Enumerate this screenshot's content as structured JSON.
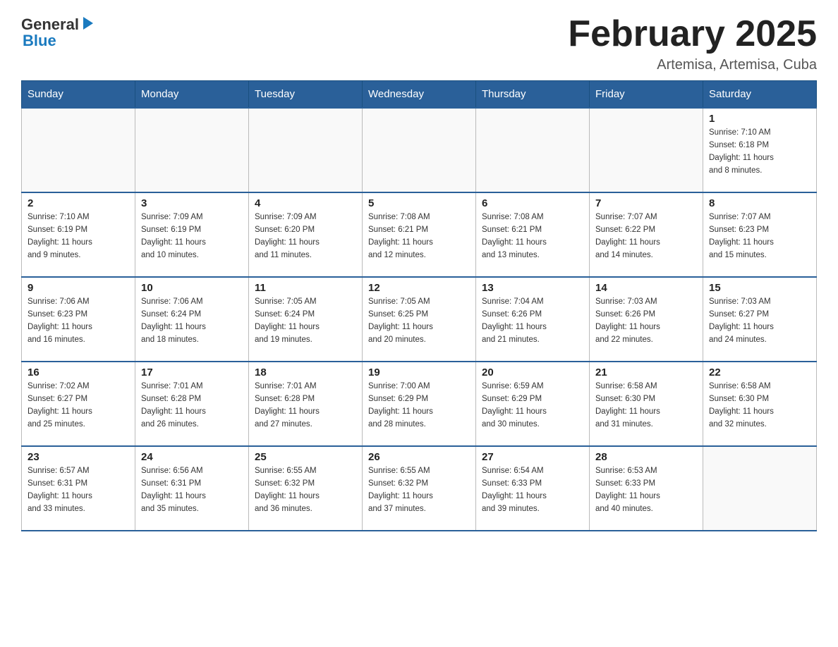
{
  "logo": {
    "general": "General",
    "blue": "Blue"
  },
  "header": {
    "month_title": "February 2025",
    "location": "Artemisa, Artemisa, Cuba"
  },
  "weekdays": [
    "Sunday",
    "Monday",
    "Tuesday",
    "Wednesday",
    "Thursday",
    "Friday",
    "Saturday"
  ],
  "weeks": [
    [
      {
        "day": "",
        "info": ""
      },
      {
        "day": "",
        "info": ""
      },
      {
        "day": "",
        "info": ""
      },
      {
        "day": "",
        "info": ""
      },
      {
        "day": "",
        "info": ""
      },
      {
        "day": "",
        "info": ""
      },
      {
        "day": "1",
        "info": "Sunrise: 7:10 AM\nSunset: 6:18 PM\nDaylight: 11 hours\nand 8 minutes."
      }
    ],
    [
      {
        "day": "2",
        "info": "Sunrise: 7:10 AM\nSunset: 6:19 PM\nDaylight: 11 hours\nand 9 minutes."
      },
      {
        "day": "3",
        "info": "Sunrise: 7:09 AM\nSunset: 6:19 PM\nDaylight: 11 hours\nand 10 minutes."
      },
      {
        "day": "4",
        "info": "Sunrise: 7:09 AM\nSunset: 6:20 PM\nDaylight: 11 hours\nand 11 minutes."
      },
      {
        "day": "5",
        "info": "Sunrise: 7:08 AM\nSunset: 6:21 PM\nDaylight: 11 hours\nand 12 minutes."
      },
      {
        "day": "6",
        "info": "Sunrise: 7:08 AM\nSunset: 6:21 PM\nDaylight: 11 hours\nand 13 minutes."
      },
      {
        "day": "7",
        "info": "Sunrise: 7:07 AM\nSunset: 6:22 PM\nDaylight: 11 hours\nand 14 minutes."
      },
      {
        "day": "8",
        "info": "Sunrise: 7:07 AM\nSunset: 6:23 PM\nDaylight: 11 hours\nand 15 minutes."
      }
    ],
    [
      {
        "day": "9",
        "info": "Sunrise: 7:06 AM\nSunset: 6:23 PM\nDaylight: 11 hours\nand 16 minutes."
      },
      {
        "day": "10",
        "info": "Sunrise: 7:06 AM\nSunset: 6:24 PM\nDaylight: 11 hours\nand 18 minutes."
      },
      {
        "day": "11",
        "info": "Sunrise: 7:05 AM\nSunset: 6:24 PM\nDaylight: 11 hours\nand 19 minutes."
      },
      {
        "day": "12",
        "info": "Sunrise: 7:05 AM\nSunset: 6:25 PM\nDaylight: 11 hours\nand 20 minutes."
      },
      {
        "day": "13",
        "info": "Sunrise: 7:04 AM\nSunset: 6:26 PM\nDaylight: 11 hours\nand 21 minutes."
      },
      {
        "day": "14",
        "info": "Sunrise: 7:03 AM\nSunset: 6:26 PM\nDaylight: 11 hours\nand 22 minutes."
      },
      {
        "day": "15",
        "info": "Sunrise: 7:03 AM\nSunset: 6:27 PM\nDaylight: 11 hours\nand 24 minutes."
      }
    ],
    [
      {
        "day": "16",
        "info": "Sunrise: 7:02 AM\nSunset: 6:27 PM\nDaylight: 11 hours\nand 25 minutes."
      },
      {
        "day": "17",
        "info": "Sunrise: 7:01 AM\nSunset: 6:28 PM\nDaylight: 11 hours\nand 26 minutes."
      },
      {
        "day": "18",
        "info": "Sunrise: 7:01 AM\nSunset: 6:28 PM\nDaylight: 11 hours\nand 27 minutes."
      },
      {
        "day": "19",
        "info": "Sunrise: 7:00 AM\nSunset: 6:29 PM\nDaylight: 11 hours\nand 28 minutes."
      },
      {
        "day": "20",
        "info": "Sunrise: 6:59 AM\nSunset: 6:29 PM\nDaylight: 11 hours\nand 30 minutes."
      },
      {
        "day": "21",
        "info": "Sunrise: 6:58 AM\nSunset: 6:30 PM\nDaylight: 11 hours\nand 31 minutes."
      },
      {
        "day": "22",
        "info": "Sunrise: 6:58 AM\nSunset: 6:30 PM\nDaylight: 11 hours\nand 32 minutes."
      }
    ],
    [
      {
        "day": "23",
        "info": "Sunrise: 6:57 AM\nSunset: 6:31 PM\nDaylight: 11 hours\nand 33 minutes."
      },
      {
        "day": "24",
        "info": "Sunrise: 6:56 AM\nSunset: 6:31 PM\nDaylight: 11 hours\nand 35 minutes."
      },
      {
        "day": "25",
        "info": "Sunrise: 6:55 AM\nSunset: 6:32 PM\nDaylight: 11 hours\nand 36 minutes."
      },
      {
        "day": "26",
        "info": "Sunrise: 6:55 AM\nSunset: 6:32 PM\nDaylight: 11 hours\nand 37 minutes."
      },
      {
        "day": "27",
        "info": "Sunrise: 6:54 AM\nSunset: 6:33 PM\nDaylight: 11 hours\nand 39 minutes."
      },
      {
        "day": "28",
        "info": "Sunrise: 6:53 AM\nSunset: 6:33 PM\nDaylight: 11 hours\nand 40 minutes."
      },
      {
        "day": "",
        "info": ""
      }
    ]
  ]
}
